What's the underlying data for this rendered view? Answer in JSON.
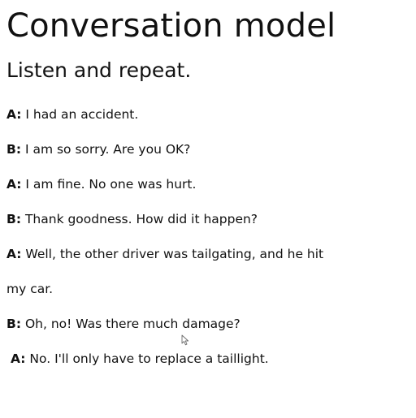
{
  "heading": {
    "title": "Conversation model",
    "subtitle": "Listen and repeat."
  },
  "dialogue": [
    {
      "speaker": "A:",
      "text": "I had an accident."
    },
    {
      "speaker": "B:",
      "text": "I am so sorry. Are you OK?"
    },
    {
      "speaker": "A:",
      "text": "I am fine. No one was hurt."
    },
    {
      "speaker": "B:",
      "text": "Thank goodness. How did it happen?"
    },
    {
      "speaker": "A:",
      "text": "Well, the other driver was tailgating, and he hit"
    },
    {
      "speaker": "",
      "text": "my car."
    },
    {
      "speaker": "B:",
      "text": "Oh, no! Was there much damage?"
    },
    {
      "speaker": "A:",
      "text": "No. I'll only have to replace a taillight."
    }
  ],
  "icons": {
    "cursor": "mouse-pointer-icon"
  }
}
